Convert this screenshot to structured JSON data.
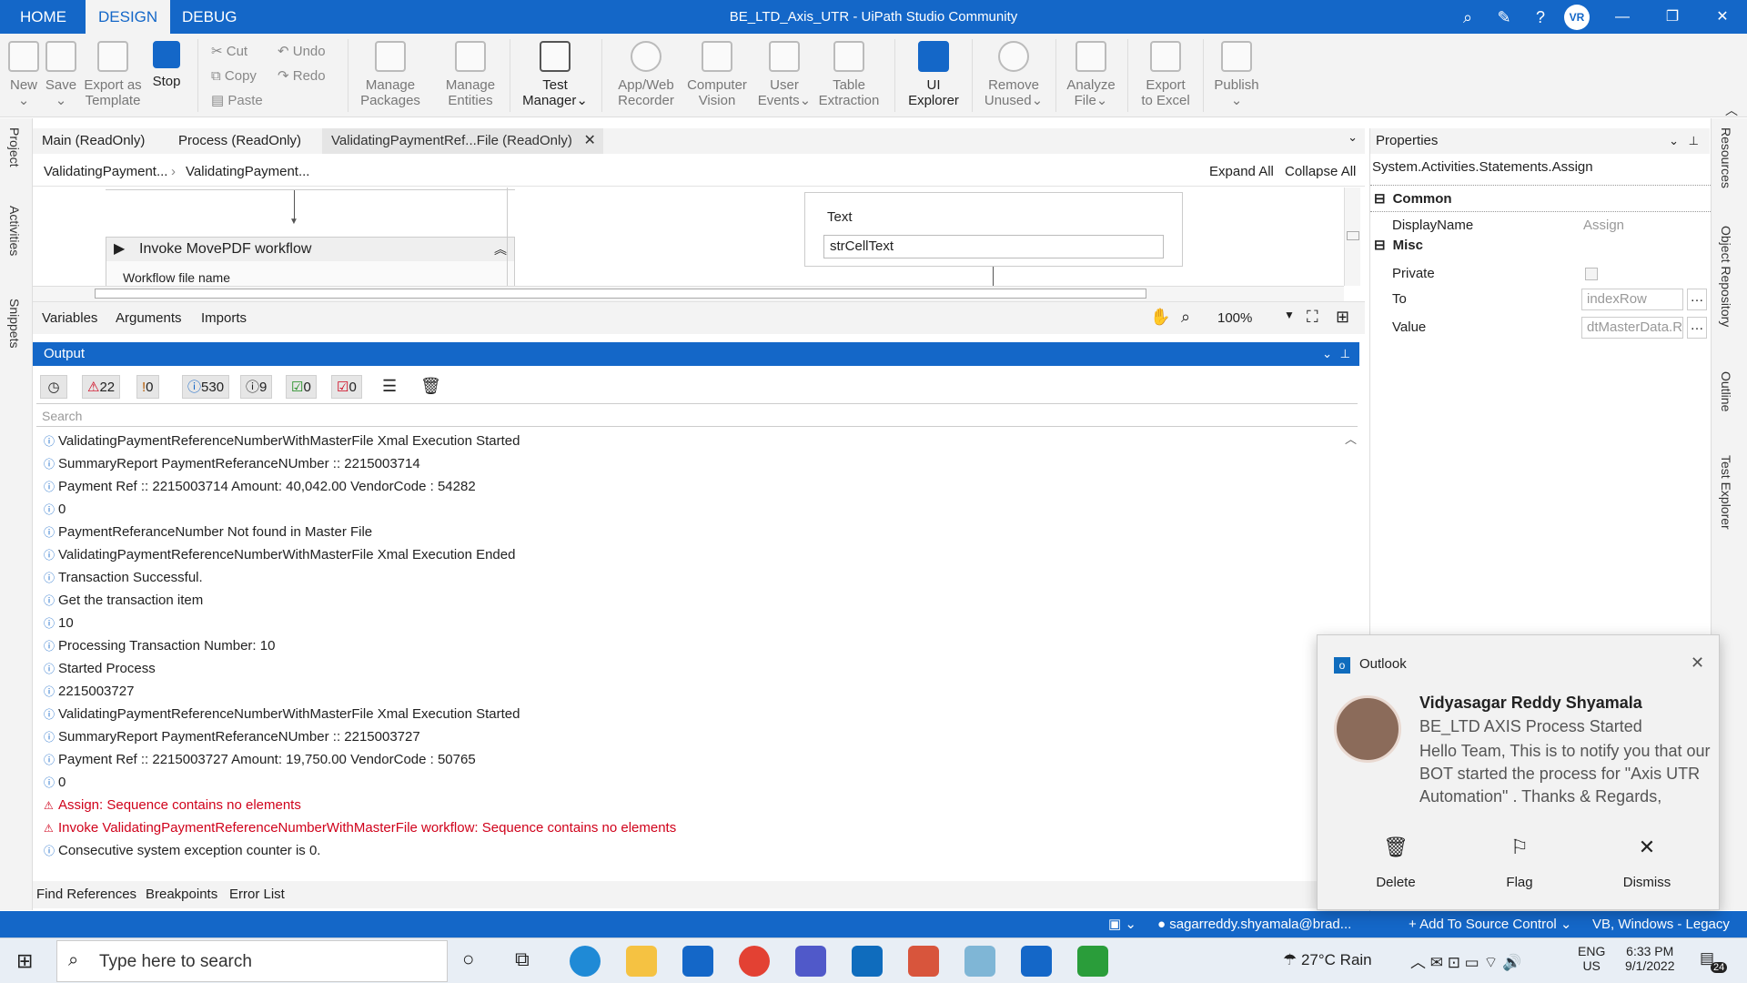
{
  "titlebar": {
    "tabs": [
      "HOME",
      "DESIGN",
      "DEBUG"
    ],
    "title": "BE_LTD_Axis_UTR - UiPath Studio Community",
    "avatar": "VR"
  },
  "ribbon": {
    "new": "New",
    "save": "Save",
    "export_as": "Export as",
    "template": "Template",
    "stop": "Stop",
    "cut": "Cut",
    "copy": "Copy",
    "paste": "Paste",
    "undo": "Undo",
    "redo": "Redo",
    "manage": "Manage",
    "packages": "Packages",
    "entities": "Entities",
    "test": "Test",
    "manager": "Manager",
    "appweb": "App/Web",
    "recorder": "Recorder",
    "computer": "Computer",
    "vision": "Vision",
    "user": "User",
    "events": "Events",
    "table": "Table",
    "extraction": "Extraction",
    "ui": "UI",
    "explorer": "Explorer",
    "remove": "Remove",
    "unused": "Unused",
    "analyze": "Analyze",
    "file": "File",
    "export": "Export",
    "to_excel": "to Excel",
    "publish": "Publish"
  },
  "side": {
    "left": [
      "Project",
      "Activities",
      "Snippets"
    ],
    "right": [
      "Resources",
      "Object Repository",
      "Outline",
      "Test Explorer"
    ]
  },
  "doctabs": [
    "Main (ReadOnly)",
    "Process (ReadOnly)",
    "ValidatingPaymentRef...File (ReadOnly)"
  ],
  "breadcrumb": [
    "ValidatingPayment...",
    "ValidatingPayment..."
  ],
  "canvas": {
    "expand_all": "Expand All",
    "collapse_all": "Collapse All",
    "invoke_title": "Invoke MovePDF workflow",
    "wf_label": "Workflow file name",
    "text_label": "Text",
    "text_value": "strCellText"
  },
  "canvas_tabs": [
    "Variables",
    "Arguments",
    "Imports"
  ],
  "zoom": "100%",
  "output": {
    "title": "Output",
    "counts": [
      "22",
      "0",
      "530",
      "9",
      "0",
      "0"
    ],
    "search_placeholder": "Search",
    "rows": [
      {
        "t": "ValidatingPaymentReferenceNumberWithMasterFile Xmal Execution Started",
        "w": false
      },
      {
        "t": "SummaryReport PaymentReferanceNUmber :: 2215003714",
        "w": false
      },
      {
        "t": "Payment Ref :: 2215003714 Amount: 40,042.00 VendorCode : 54282",
        "w": false
      },
      {
        "t": "0",
        "w": false
      },
      {
        "t": "PaymentReferanceNumber Not found in Master File",
        "w": false
      },
      {
        "t": "ValidatingPaymentReferenceNumberWithMasterFile Xmal Execution Ended",
        "w": false
      },
      {
        "t": "Transaction Successful.",
        "w": false
      },
      {
        "t": "Get the transaction item",
        "w": false
      },
      {
        "t": "10",
        "w": false
      },
      {
        "t": "Processing Transaction Number: 10",
        "w": false
      },
      {
        "t": "Started Process",
        "w": false
      },
      {
        "t": "2215003727",
        "w": false
      },
      {
        "t": "ValidatingPaymentReferenceNumberWithMasterFile Xmal Execution Started",
        "w": false
      },
      {
        "t": "SummaryReport PaymentReferanceNUmber :: 2215003727",
        "w": false
      },
      {
        "t": "Payment Ref :: 2215003727 Amount: 19,750.00 VendorCode : 50765",
        "w": false
      },
      {
        "t": "0",
        "w": false
      },
      {
        "t": "Assign: Sequence contains no elements",
        "w": true
      },
      {
        "t": "Invoke ValidatingPaymentReferenceNumberWithMasterFile workflow: Sequence contains no elements",
        "w": true
      },
      {
        "t": "Consecutive system exception counter is 0.",
        "w": false
      }
    ]
  },
  "bottom_tabs": [
    "Find References",
    "Breakpoints",
    "Error List"
  ],
  "properties": {
    "title": "Properties",
    "type": "System.Activities.Statements.Assign",
    "common": "Common",
    "display_name": "DisplayName",
    "display_value": "Assign",
    "misc": "Misc",
    "private": "Private",
    "to": "To",
    "to_value": "indexRow",
    "value": "Value",
    "value_value": "dtMasterData.R"
  },
  "statusbar": {
    "user": "sagarreddy.shyamala@brad...",
    "source": "Add To Source Control",
    "lang": "VB, Windows - Legacy"
  },
  "taskbar": {
    "search": "Type here to search",
    "weather": "27°C  Rain",
    "lang1": "ENG",
    "lang2": "US",
    "time": "6:33 PM",
    "date": "9/1/2022",
    "notif": "24"
  },
  "toast": {
    "app": "Outlook",
    "sender": "Vidyasagar Reddy Shyamala",
    "subject": "BE_LTD AXIS Process Started",
    "body": "Hello Team,   This is to notify you that our BOT started the process for \"Axis UTR Automation\" .  Thanks & Regards,",
    "delete": "Delete",
    "flag": "Flag",
    "dismiss": "Dismiss"
  },
  "colors": {
    "accent": "#1467c8",
    "warning": "#d0021b",
    "info": "#1467c8"
  }
}
